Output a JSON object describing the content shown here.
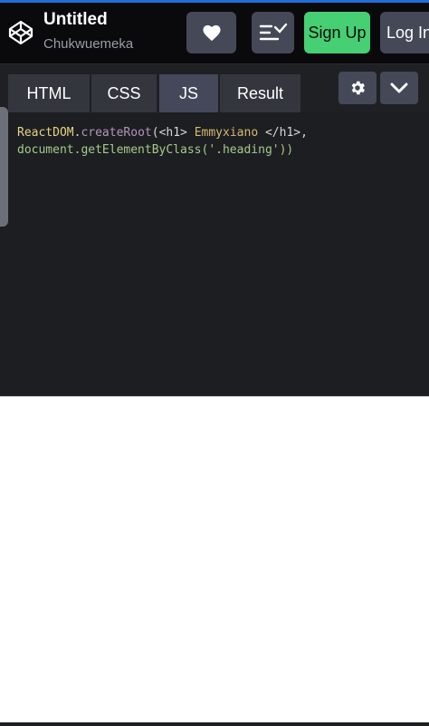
{
  "header": {
    "title": "Untitled",
    "author": "Chukwuemeka",
    "signup_label": "Sign Up",
    "login_label": "Log In"
  },
  "tabs": [
    "HTML",
    "CSS",
    "JS",
    "Result"
  ],
  "active_tab": "JS",
  "code": {
    "line1": {
      "obj": "ReactDOM",
      "dot": ".",
      "method": "createRoot",
      "open": "(",
      "tag_open": "<h1>",
      "text": " Emmyxiano ",
      "tag_close": "</h1>",
      "comma": ","
    },
    "line2": {
      "call": "document.getElementByClass(",
      "arg": "'.heading'",
      "close": "))"
    }
  },
  "icons": {
    "logo": "codepen-logo-icon",
    "heart": "heart-icon",
    "menu": "sort-menu-icon",
    "settings": "gear-icon",
    "collapse": "chevron-down-icon"
  },
  "colors": {
    "accent_green": "#47cf73",
    "button_gray": "#444857",
    "editor_bg": "#1d1e22"
  }
}
